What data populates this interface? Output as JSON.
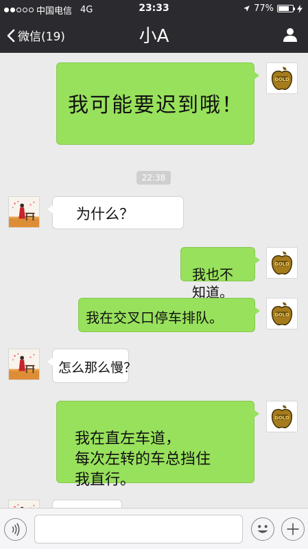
{
  "status_bar": {
    "carrier": "中国电信",
    "network": "4G",
    "time": "23:33",
    "battery_percent": "77%",
    "battery_level": 0.77
  },
  "nav": {
    "back_label": "微信(19)",
    "title": "小A"
  },
  "messages": [
    {
      "side": "right",
      "text": "我可能要迟到哦！"
    },
    {
      "side": "left",
      "text": "为什么？"
    },
    {
      "side": "right",
      "text": "我也不\n知道。"
    },
    {
      "side": "right",
      "text": "我在交叉口停车排队。"
    },
    {
      "side": "left",
      "text": "怎么那么慢？"
    },
    {
      "side": "right",
      "text": "我在直左车道，\n每次左转的车总挡住\n我直行。"
    }
  ],
  "timestamp_chip": "22:38",
  "input": {
    "placeholder": ""
  },
  "icons": {
    "back": "chevron-left-icon",
    "profile": "person-icon",
    "voice": "voice-icon",
    "emoji": "emoji-icon",
    "plus": "plus-icon"
  },
  "colors": {
    "nav_bg": "#2b2b2f",
    "chat_bg": "#ebebeb",
    "sent_bubble": "#98e15c",
    "received_bubble": "#ffffff"
  }
}
